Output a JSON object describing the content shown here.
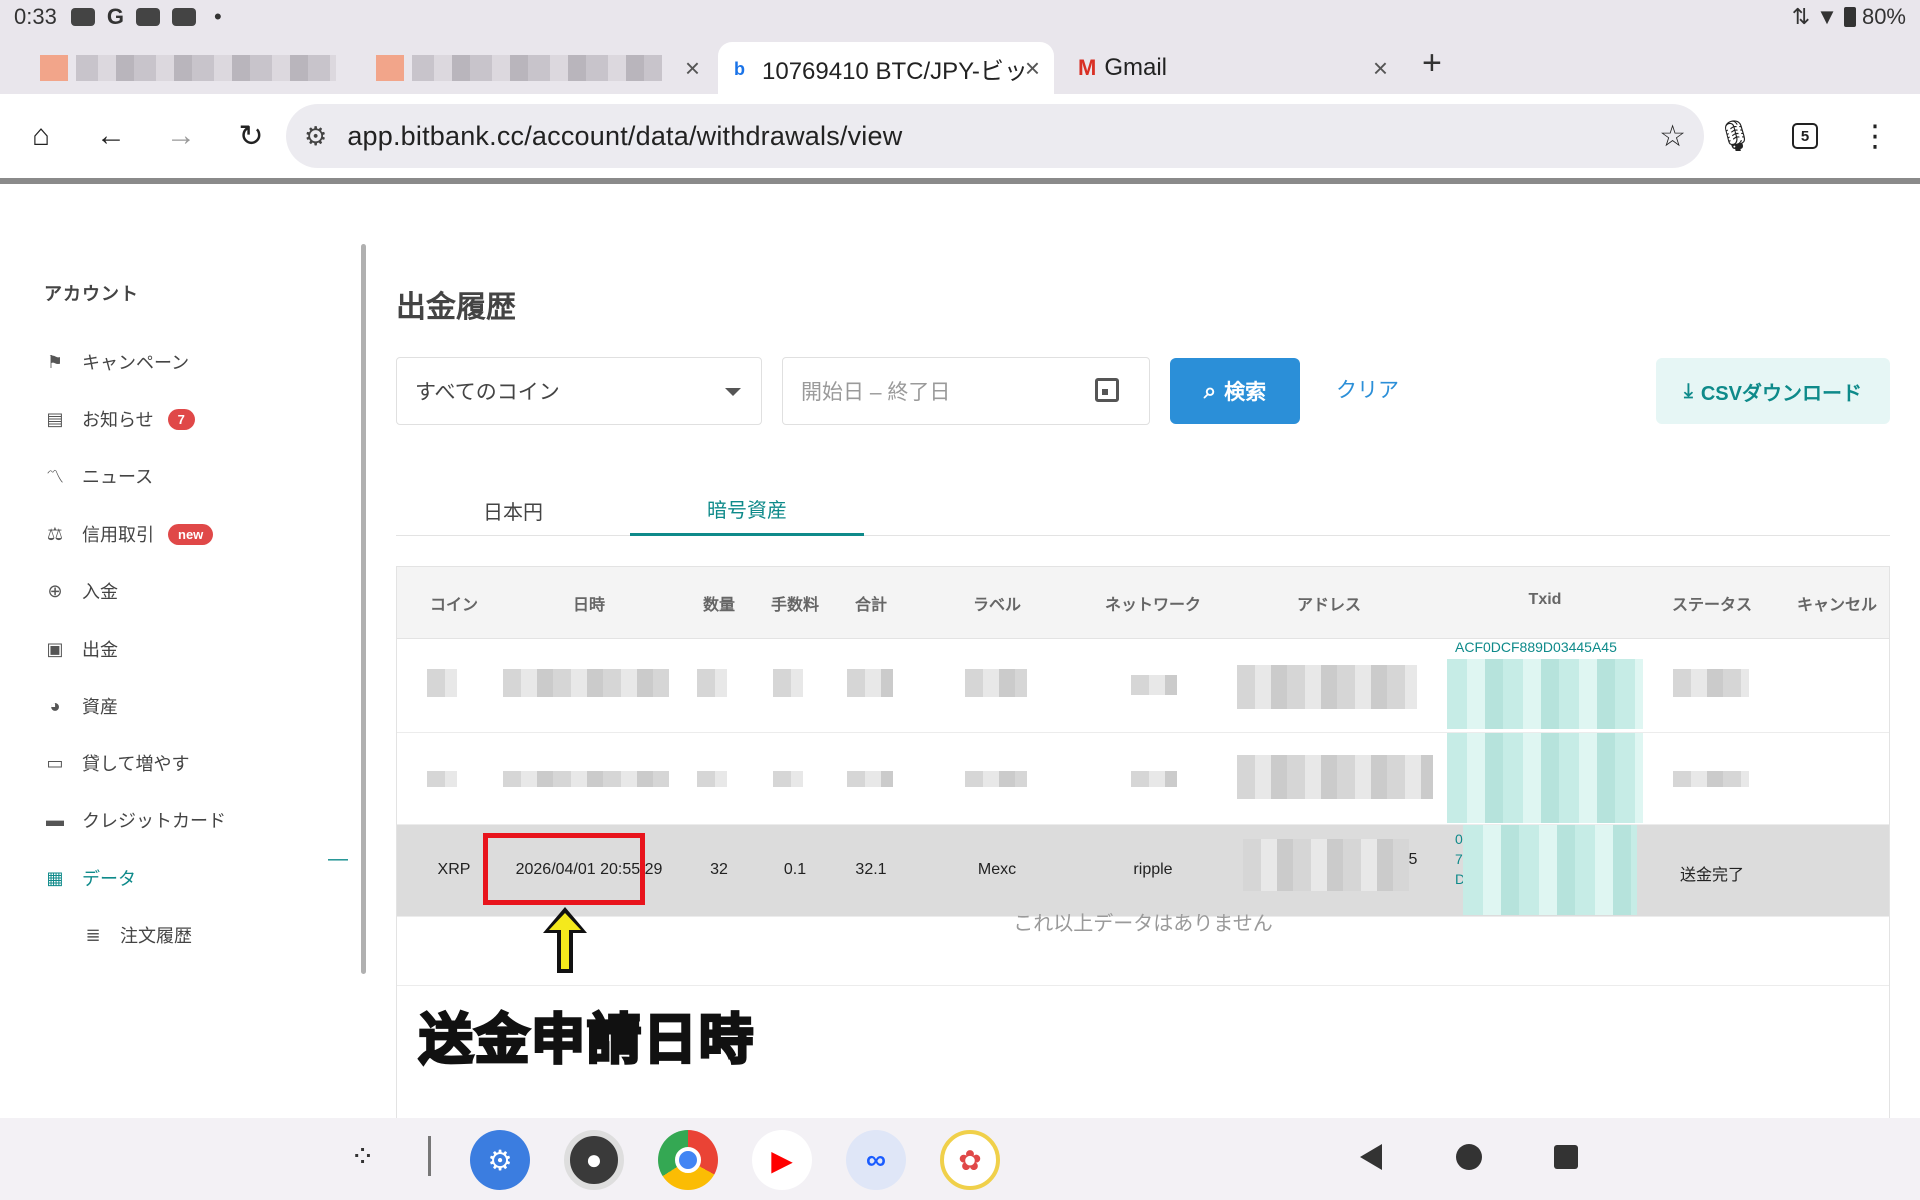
{
  "status_bar": {
    "time": "0:33",
    "g": "G",
    "dot": "•",
    "battery": "80%"
  },
  "browser": {
    "tabs": [
      {
        "title": "10769410 BTC/JPY-ビッ"
      },
      {
        "title": "Gmail"
      }
    ],
    "new_tab": "+",
    "url": "app.bitbank.cc/account/data/withdrawals/view",
    "tab_count": "5"
  },
  "sidebar": {
    "title": "アカウント",
    "items": [
      {
        "label": "キャンペーン"
      },
      {
        "label": "お知らせ",
        "badge": "7"
      },
      {
        "label": "ニュース"
      },
      {
        "label": "信用取引",
        "badge": "new"
      },
      {
        "label": "入金"
      },
      {
        "label": "出金"
      },
      {
        "label": "資産"
      },
      {
        "label": "貸して増やす"
      },
      {
        "label": "クレジットカード"
      },
      {
        "label": "データ"
      },
      {
        "label": "注文履歴"
      }
    ],
    "collapse_symbol": "—"
  },
  "main": {
    "title": "出金履歴",
    "coin_select": "すべてのコイン",
    "date_placeholder": "開始日 – 終了日",
    "search_label": "検索",
    "clear_label": "クリア",
    "csv_label": "CSVダウンロード",
    "tabs": [
      {
        "label": "日本円"
      },
      {
        "label": "暗号資産"
      }
    ],
    "columns": [
      "コイン",
      "日時",
      "数量",
      "手数料",
      "合計",
      "ラベル",
      "ネットワーク",
      "アドレス",
      "Txid",
      "ステータス",
      "キャンセル"
    ],
    "txid_partial_top": "ACF0DCF889D03445A45",
    "row": {
      "coin": "XRP",
      "datetime": "2026/04/01 20:55:29",
      "amount": "32",
      "fee": "0.1",
      "total": "32.1",
      "label": "Mexc",
      "network": "ripple",
      "address_tail": "5",
      "txid_frag_1": "0",
      "txid_frag_2": "7",
      "txid_frag_3": "D",
      "status": "送金完了"
    },
    "no_more": "これ以上データはありません"
  },
  "annotation": {
    "text": "送金申請日時",
    "color": "#f4e91c",
    "box_color": "#e8141c"
  },
  "colors": {
    "accent": "#0e8a8a",
    "primary_button": "#2b8fd8",
    "badge": "#e04848"
  }
}
